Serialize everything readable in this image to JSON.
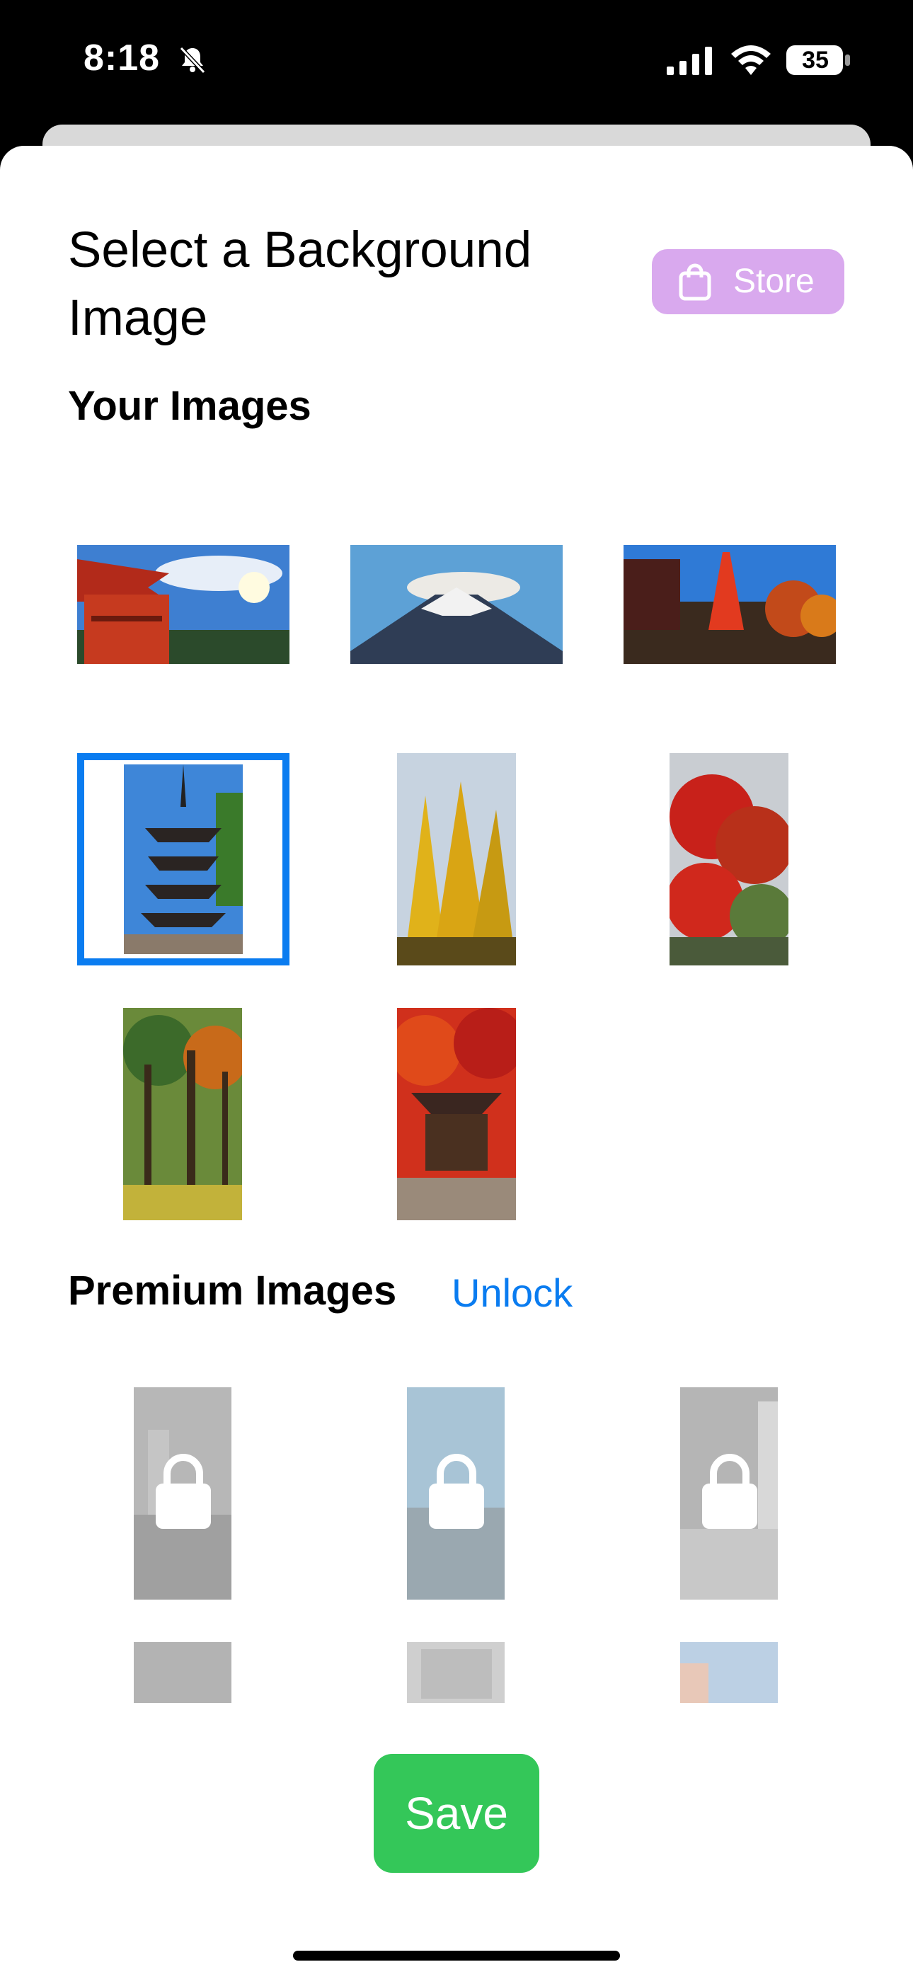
{
  "status_bar": {
    "time": "8:18",
    "battery": "35"
  },
  "header": {
    "title": "Select a Background Image",
    "store_label": "Store"
  },
  "your_images": {
    "heading": "Your Images",
    "items": [
      {
        "name": "pagoda-red-sky"
      },
      {
        "name": "mount-fuji"
      },
      {
        "name": "tokyo-tower"
      },
      {
        "name": "pagoda-dark",
        "selected": true
      },
      {
        "name": "ginkgo-trees"
      },
      {
        "name": "red-maple"
      },
      {
        "name": "forest-path"
      },
      {
        "name": "temple-autumn"
      }
    ]
  },
  "premium_images": {
    "heading": "Premium Images",
    "unlock_label": "Unlock"
  },
  "footer": {
    "save_label": "Save"
  },
  "colors": {
    "accent": "#0a7cf0",
    "save": "#34c759",
    "store": "#d9a9ee"
  }
}
